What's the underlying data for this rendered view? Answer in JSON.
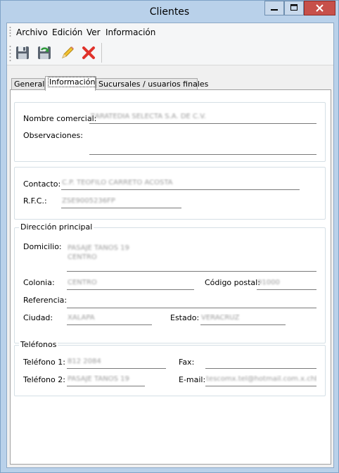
{
  "window": {
    "title": "Clientes"
  },
  "menu": [
    "Archivo",
    "Edición",
    "Ver",
    "Información"
  ],
  "toolbar": {
    "icons": [
      "save-icon",
      "save-refresh-icon",
      "edit-pencil-icon",
      "delete-x-icon"
    ]
  },
  "tabs": [
    {
      "label": "General",
      "active": false
    },
    {
      "label": "Información",
      "active": true
    },
    {
      "label": "Sucursales / usuarios finales",
      "active": false
    }
  ],
  "info": {
    "nombre_comercial_label": "Nombre comercial:",
    "nombre_comercial_value": "ZARATEDIA SELECTA S.A. DE C.V.",
    "observaciones_label": "Observaciones:",
    "observaciones_value": ""
  },
  "contact": {
    "contacto_label": "Contacto:",
    "contacto_value": "C.P. TEOFILO CARRETO ACOSTA",
    "rfc_label": "R.F.C.:",
    "rfc_value": "ZSE9005236FP"
  },
  "address": {
    "legend": "Dirección principal",
    "domicilio_label": "Domicilio:",
    "domicilio_line1": "PASAJE TANOS 19",
    "domicilio_line2": "CENTRO",
    "colonia_label": "Colonia:",
    "colonia_value": "CENTRO",
    "cp_label": "Código postal:",
    "cp_value": "91000",
    "referencia_label": "Referencia:",
    "referencia_value": "",
    "ciudad_label": "Ciudad:",
    "ciudad_value": "XALAPA",
    "estado_label": "Estado:",
    "estado_value": "VERACRUZ"
  },
  "phones": {
    "legend": "Teléfonos",
    "tel1_label": "Teléfono 1:",
    "tel1_value": "812 2084",
    "fax_label": "Fax:",
    "fax_value": "",
    "tel2_label": "Teléfono 2:",
    "tel2_value": "PASAJE TANOS 19",
    "email_label": "E-mail:",
    "email_value": "tescomx.tel@hotmail.com.x.chbc"
  }
}
